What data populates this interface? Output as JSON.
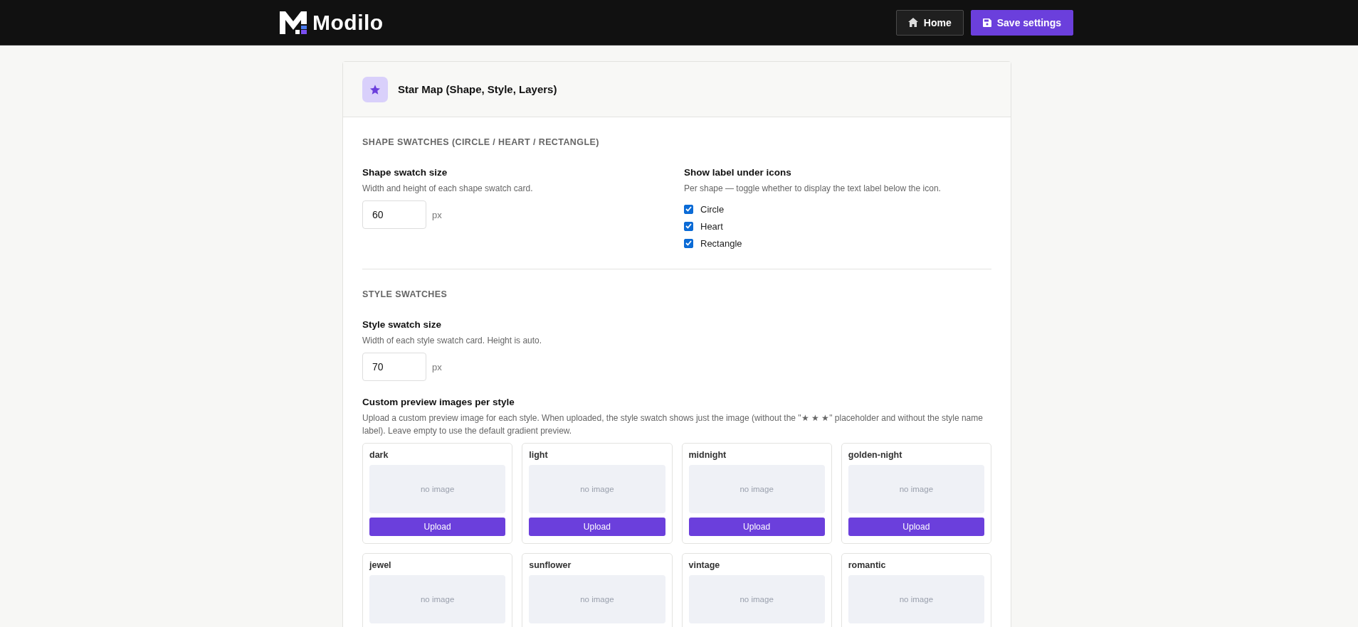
{
  "header": {
    "brand": "Modilo",
    "buttons": [
      {
        "kind": "home",
        "label": "Home"
      },
      {
        "kind": "save",
        "label": "Save settings"
      }
    ]
  },
  "card": {
    "title": "Star Map (Shape, Style, Layers)",
    "sections": [
      {
        "title": "SHAPE SWATCHES (CIRCLE / HEART / RECTANGLE)",
        "left": {
          "label": "Shape swatch size",
          "help": "Width and height of each shape swatch card.",
          "value": "60",
          "unit": "px"
        },
        "right": {
          "label": "Show label under icons",
          "help": "Per shape — toggle whether to display the text label below the icon.",
          "options": [
            {
              "label": "Circle",
              "checked": true
            },
            {
              "label": "Heart",
              "checked": true
            },
            {
              "label": "Rectangle",
              "checked": true
            }
          ]
        }
      },
      {
        "title": "STYLE SWATCHES",
        "left": {
          "label": "Style swatch size",
          "help": "Width of each style swatch card. Height is auto.",
          "value": "70",
          "unit": "px"
        },
        "previews": {
          "label": "Custom preview images per style",
          "help": "Upload a custom preview image for each style. When uploaded, the style swatch shows just the image (without the \"★ ★ ★\" placeholder and without the style name label). Leave empty to use the default gradient preview.",
          "styles": [
            {
              "name": "dark",
              "preview": "no image",
              "button": "Upload"
            },
            {
              "name": "light",
              "preview": "no image",
              "button": "Upload"
            },
            {
              "name": "midnight",
              "preview": "no image",
              "button": "Upload"
            },
            {
              "name": "golden-night",
              "preview": "no image",
              "button": "Upload"
            },
            {
              "name": "jewel",
              "preview": "no image"
            },
            {
              "name": "sunflower",
              "preview": "no image"
            },
            {
              "name": "vintage",
              "preview": "no image"
            },
            {
              "name": "romantic",
              "preview": "no image"
            }
          ]
        }
      }
    ]
  }
}
